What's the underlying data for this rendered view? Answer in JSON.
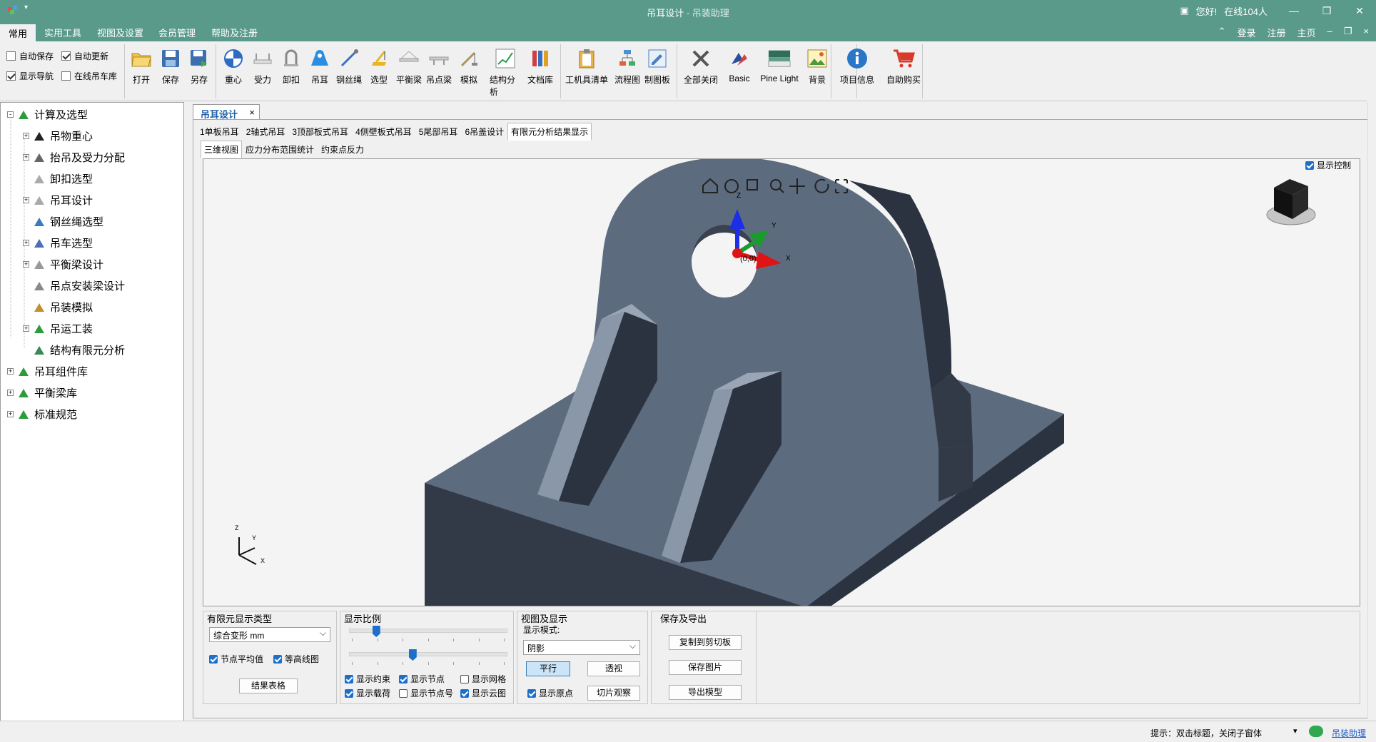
{
  "window": {
    "title": "吊耳设计",
    "subtitle": " - 吊装助理",
    "greeting": "您好!",
    "online": "在线104人"
  },
  "menu": {
    "tabs": [
      "常用",
      "实用工具",
      "视图及设置",
      "会员管理",
      "帮助及注册"
    ],
    "right": {
      "login": "登录",
      "register": "注册",
      "home": "主页"
    }
  },
  "ribbon": {
    "checks": [
      {
        "label": "自动保存",
        "checked": false
      },
      {
        "label": "自动更新",
        "checked": true
      },
      {
        "label": "显示导航",
        "checked": true
      },
      {
        "label": "在线吊车库",
        "checked": false
      }
    ],
    "buttons": [
      "打开",
      "保存",
      "另存",
      "重心",
      "受力",
      "卸扣",
      "吊耳",
      "钢丝绳",
      "选型",
      "平衡梁",
      "吊点梁",
      "模拟",
      "结构分析",
      "文档库",
      "工机具清单",
      "流程图",
      "制图板",
      "全部关闭",
      "Basic",
      "Pine Light",
      "背景",
      "项目信息",
      "自助购买"
    ]
  },
  "tree": [
    {
      "label": "计算及选型",
      "level": 0,
      "expander": "-"
    },
    {
      "label": "吊物重心",
      "level": 1,
      "expander": "+"
    },
    {
      "label": "抬吊及受力分配",
      "level": 1,
      "expander": "+"
    },
    {
      "label": "卸扣选型",
      "level": 1,
      "expander": ""
    },
    {
      "label": "吊耳设计",
      "level": 1,
      "expander": "+"
    },
    {
      "label": "钢丝绳选型",
      "level": 1,
      "expander": ""
    },
    {
      "label": "吊车选型",
      "level": 1,
      "expander": "+"
    },
    {
      "label": "平衡梁设计",
      "level": 1,
      "expander": "+"
    },
    {
      "label": "吊点安装梁设计",
      "level": 1,
      "expander": ""
    },
    {
      "label": "吊装模拟",
      "level": 1,
      "expander": ""
    },
    {
      "label": "吊运工装",
      "level": 1,
      "expander": "+"
    },
    {
      "label": "结构有限元分析",
      "level": 1,
      "expander": ""
    },
    {
      "label": "吊耳组件库",
      "level": 0,
      "expander": "+"
    },
    {
      "label": "平衡梁库",
      "level": 0,
      "expander": "+"
    },
    {
      "label": "标准规范",
      "level": 0,
      "expander": "+"
    }
  ],
  "doc": {
    "tab_label": "吊耳设计",
    "tab_close": "×",
    "tabs": [
      "1单板吊耳",
      "2轴式吊耳",
      "3顶部板式吊耳",
      "4侧壁板式吊耳",
      "5尾部吊耳",
      "6吊盖设计",
      "有限元分析结果显示"
    ],
    "inner_tabs": [
      "三维视图",
      "应力分布范围统计",
      "约束点反力"
    ]
  },
  "viewport": {
    "show_control": "显示控制",
    "origin_label": "(0,0)",
    "axes": {
      "x": "X",
      "y": "Y",
      "z": "Z"
    }
  },
  "panels": {
    "fem": {
      "title": "有限元显示类型",
      "type_value": "综合变形 mm",
      "chk_node_avg": "节点平均值",
      "chk_contour": "等高线图",
      "result_button": "结果表格"
    },
    "scale": {
      "title": "显示比例",
      "slider1": 0.17,
      "slider2": 0.4,
      "checks": [
        {
          "label": "显示约束",
          "checked": true
        },
        {
          "label": "显示节点",
          "checked": true
        },
        {
          "label": "显示网格",
          "checked": false
        },
        {
          "label": "显示载荷",
          "checked": true
        },
        {
          "label": "显示节点号",
          "checked": false
        },
        {
          "label": "显示云图",
          "checked": true
        }
      ]
    },
    "view": {
      "title": "视图及显示",
      "mode_label": "显示模式:",
      "mode_value": "阴影",
      "parallel": "平行",
      "perspective": "透视",
      "show_origin": "显示原点",
      "slice": "切片观察"
    },
    "export": {
      "title": "保存及导出",
      "copy": "复制到剪切板",
      "save_image": "保存图片",
      "export_model": "导出模型"
    }
  },
  "status": {
    "hint": "提示：双击标题，关闭子窗体",
    "link": "吊装助理"
  },
  "colors": {
    "titlebar": "#5a9a8a",
    "model_top": "#5d6b7e",
    "model_dark": "#323a48",
    "accent": "#1e6fcb"
  }
}
